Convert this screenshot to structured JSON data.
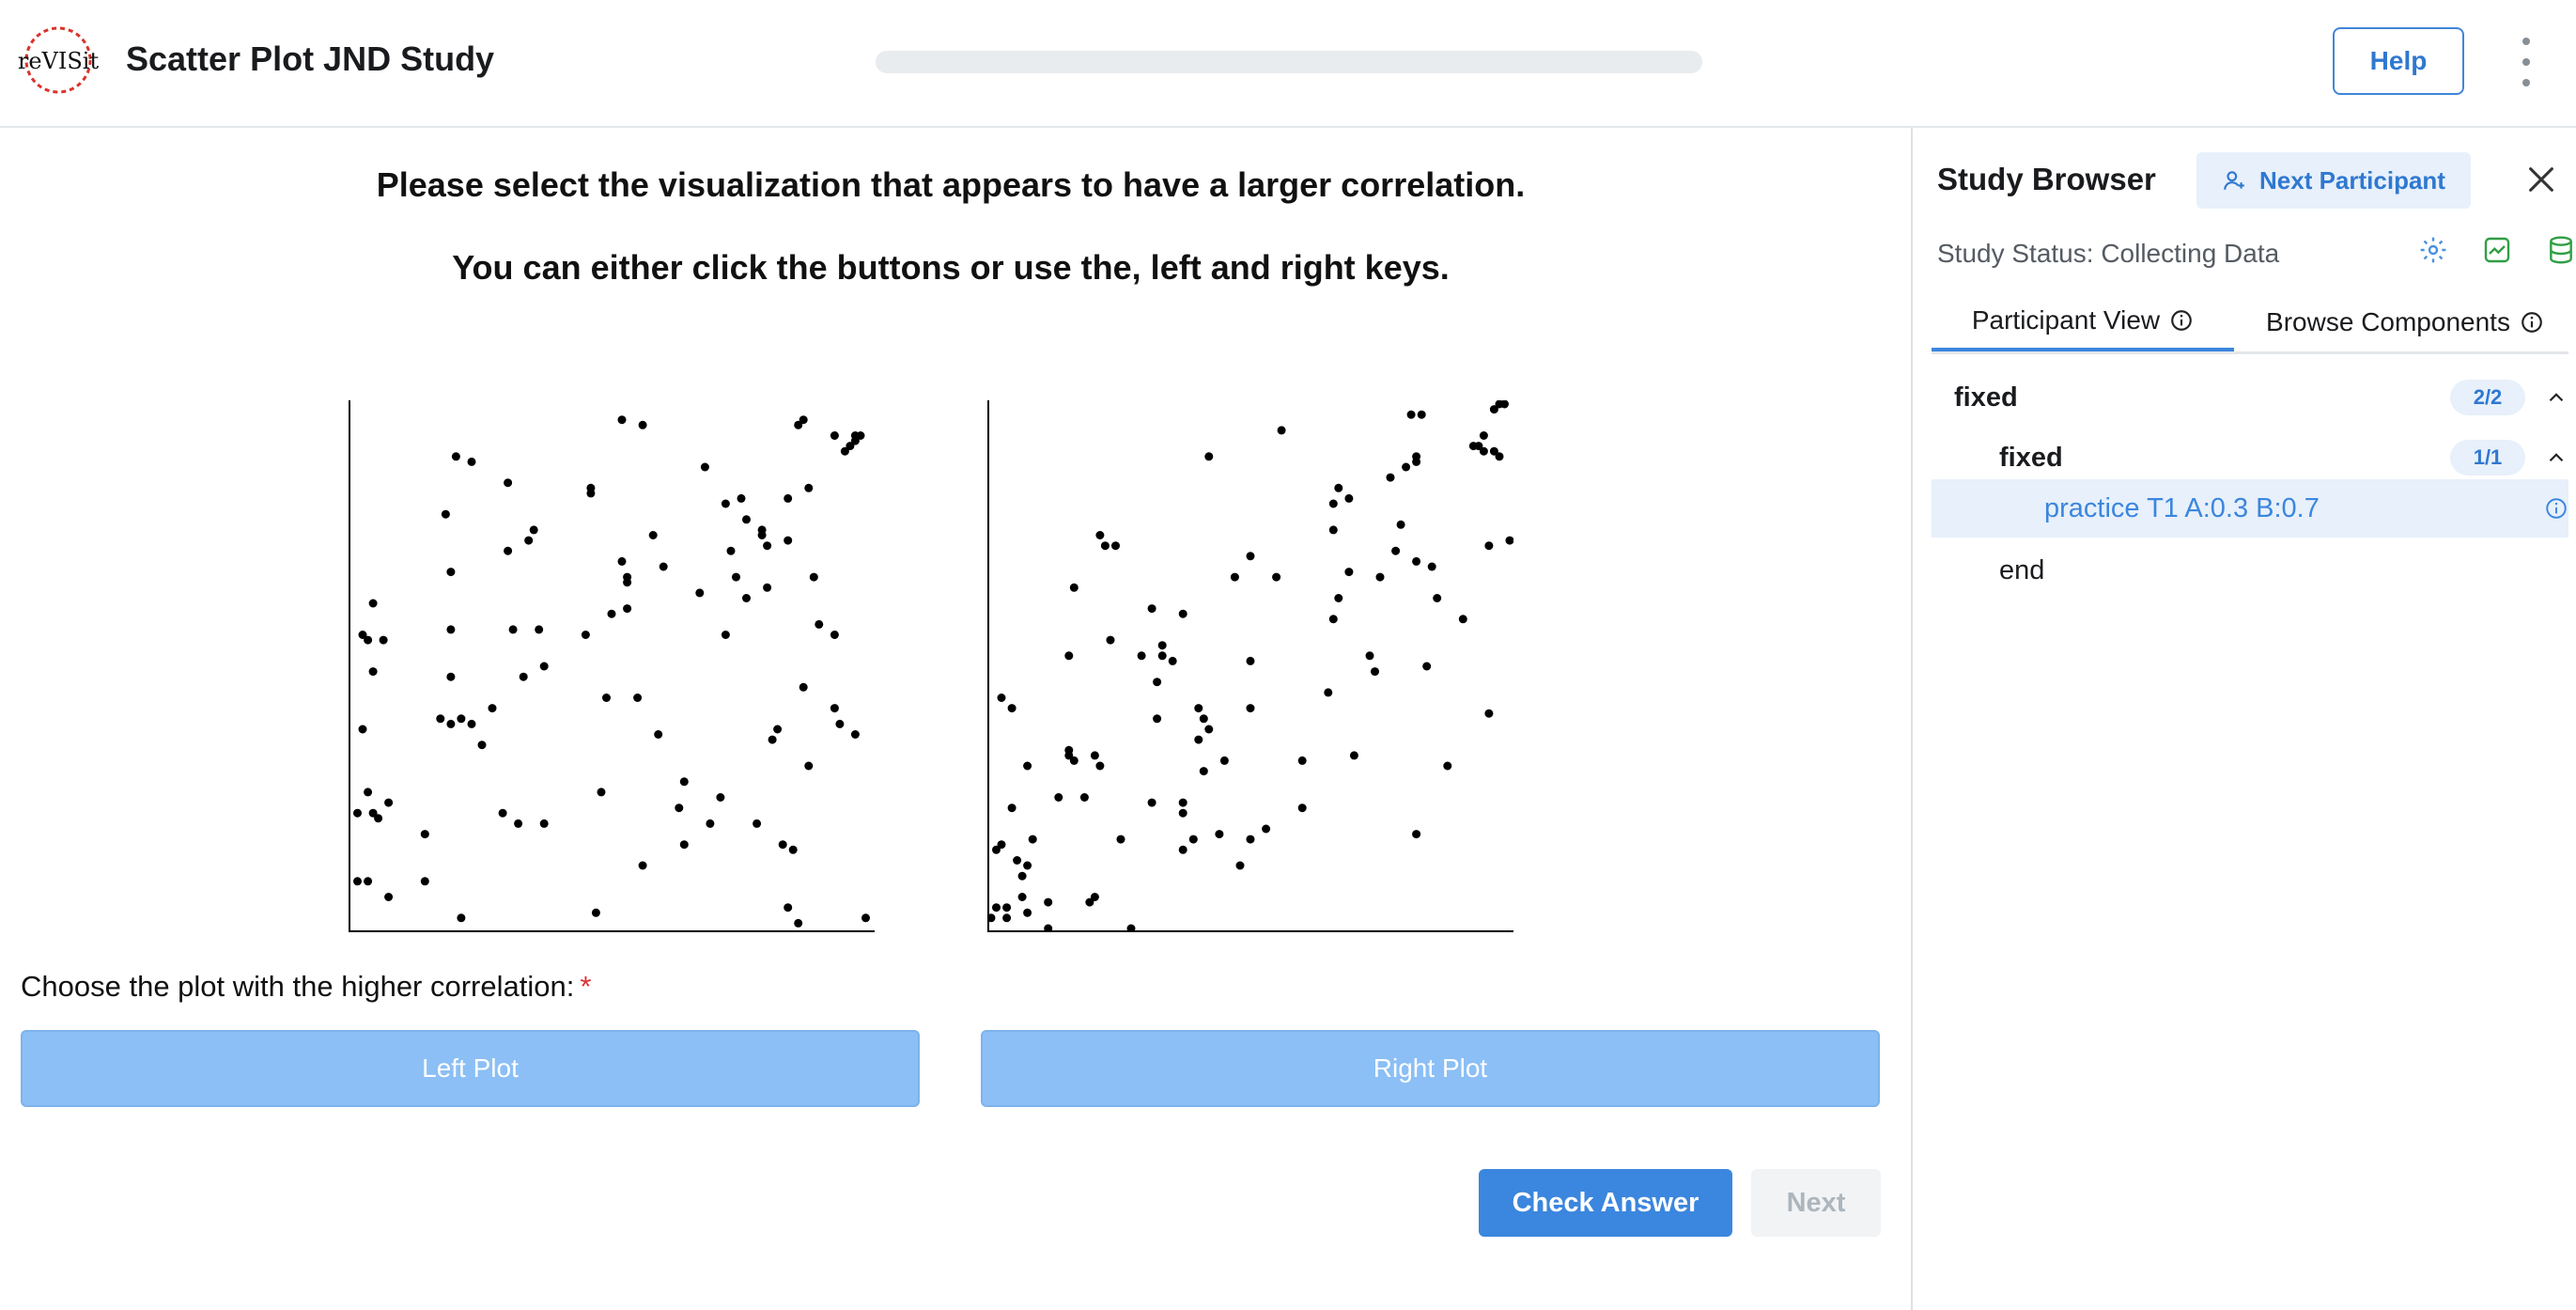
{
  "header": {
    "logo_text": "reVISit",
    "title": "Scatter Plot JND Study",
    "progress": 0,
    "help_label": "Help"
  },
  "main": {
    "instruction_1": "Please select the visualization that appears to have a larger correlation.",
    "instruction_2": "You can either click the buttons or use the, left and right keys.",
    "question": "Choose the plot with the higher correlation:",
    "required_mark": "*",
    "left_button": "Left Plot",
    "right_button": "Right Plot",
    "check_answer": "Check Answer",
    "next": "Next"
  },
  "chart_data": [
    {
      "type": "scatter",
      "title": "",
      "xlim": [
        0,
        1
      ],
      "ylim": [
        0,
        1
      ],
      "points": [
        [
          0.01,
          0.09
        ],
        [
          0.01,
          0.22
        ],
        [
          0.02,
          0.38
        ],
        [
          0.02,
          0.56
        ],
        [
          0.03,
          0.09
        ],
        [
          0.03,
          0.26
        ],
        [
          0.04,
          0.22
        ],
        [
          0.04,
          0.49
        ],
        [
          0.03,
          0.55
        ],
        [
          0.04,
          0.62
        ],
        [
          0.06,
          0.55
        ],
        [
          0.07,
          0.24
        ],
        [
          0.07,
          0.06
        ],
        [
          0.05,
          0.21
        ],
        [
          0.14,
          0.09
        ],
        [
          0.14,
          0.18
        ],
        [
          0.17,
          0.4
        ],
        [
          0.18,
          0.79
        ],
        [
          0.19,
          0.68
        ],
        [
          0.19,
          0.57
        ],
        [
          0.19,
          0.48
        ],
        [
          0.19,
          0.39
        ],
        [
          0.2,
          0.9
        ],
        [
          0.21,
          0.4
        ],
        [
          0.21,
          0.02
        ],
        [
          0.23,
          0.39
        ],
        [
          0.23,
          0.89
        ],
        [
          0.25,
          0.35
        ],
        [
          0.27,
          0.42
        ],
        [
          0.29,
          0.22
        ],
        [
          0.3,
          0.85
        ],
        [
          0.3,
          0.72
        ],
        [
          0.31,
          0.57
        ],
        [
          0.32,
          0.2
        ],
        [
          0.33,
          0.48
        ],
        [
          0.34,
          0.74
        ],
        [
          0.35,
          0.76
        ],
        [
          0.36,
          0.57
        ],
        [
          0.37,
          0.5
        ],
        [
          0.37,
          0.2
        ],
        [
          0.45,
          0.56
        ],
        [
          0.46,
          0.83
        ],
        [
          0.46,
          0.84
        ],
        [
          0.47,
          0.03
        ],
        [
          0.48,
          0.26
        ],
        [
          0.49,
          0.44
        ],
        [
          0.5,
          0.6
        ],
        [
          0.52,
          0.7
        ],
        [
          0.53,
          0.66
        ],
        [
          0.53,
          0.67
        ],
        [
          0.53,
          0.61
        ],
        [
          0.52,
          0.97
        ],
        [
          0.56,
          0.96
        ],
        [
          0.55,
          0.44
        ],
        [
          0.56,
          0.12
        ],
        [
          0.58,
          0.75
        ],
        [
          0.59,
          0.37
        ],
        [
          0.6,
          0.69
        ],
        [
          0.63,
          0.23
        ],
        [
          0.64,
          0.16
        ],
        [
          0.64,
          0.28
        ],
        [
          0.67,
          0.64
        ],
        [
          0.68,
          0.88
        ],
        [
          0.69,
          0.2
        ],
        [
          0.71,
          0.25
        ],
        [
          0.72,
          0.81
        ],
        [
          0.72,
          0.56
        ],
        [
          0.73,
          0.72
        ],
        [
          0.74,
          0.67
        ],
        [
          0.75,
          0.82
        ],
        [
          0.76,
          0.63
        ],
        [
          0.76,
          0.78
        ],
        [
          0.78,
          0.2
        ],
        [
          0.79,
          0.76
        ],
        [
          0.79,
          0.75
        ],
        [
          0.8,
          0.73
        ],
        [
          0.81,
          0.36
        ],
        [
          0.82,
          0.38
        ],
        [
          0.8,
          0.65
        ],
        [
          0.83,
          0.16
        ],
        [
          0.84,
          0.04
        ],
        [
          0.84,
          0.74
        ],
        [
          0.84,
          0.82
        ],
        [
          0.85,
          0.15
        ],
        [
          0.86,
          0.96
        ],
        [
          0.87,
          0.97
        ],
        [
          0.86,
          0.01
        ],
        [
          0.88,
          0.31
        ],
        [
          0.88,
          0.84
        ],
        [
          0.87,
          0.46
        ],
        [
          0.89,
          0.67
        ],
        [
          0.9,
          0.58
        ],
        [
          0.93,
          0.56
        ],
        [
          0.93,
          0.42
        ],
        [
          0.93,
          0.94
        ],
        [
          0.94,
          0.39
        ],
        [
          0.95,
          0.91
        ],
        [
          0.96,
          0.92
        ],
        [
          0.97,
          0.94
        ],
        [
          0.97,
          0.37
        ],
        [
          0.97,
          0.93
        ],
        [
          0.98,
          0.94
        ],
        [
          0.99,
          0.02
        ]
      ]
    },
    {
      "type": "scatter",
      "title": "",
      "xlim": [
        0,
        1
      ],
      "ylim": [
        0,
        1
      ],
      "points": [
        [
          0.0,
          0.02
        ],
        [
          0.01,
          0.04
        ],
        [
          0.01,
          0.15
        ],
        [
          0.02,
          0.16
        ],
        [
          0.02,
          0.44
        ],
        [
          0.03,
          0.04
        ],
        [
          0.03,
          0.02
        ],
        [
          0.04,
          0.42
        ],
        [
          0.04,
          0.23
        ],
        [
          0.05,
          0.13
        ],
        [
          0.06,
          0.06
        ],
        [
          0.06,
          0.1
        ],
        [
          0.07,
          0.03
        ],
        [
          0.07,
          0.12
        ],
        [
          0.08,
          0.17
        ],
        [
          0.07,
          0.31
        ],
        [
          0.11,
          0.05
        ],
        [
          0.11,
          0.0
        ],
        [
          0.13,
          0.25
        ],
        [
          0.15,
          0.33
        ],
        [
          0.15,
          0.52
        ],
        [
          0.15,
          0.34
        ],
        [
          0.16,
          0.32
        ],
        [
          0.16,
          0.65
        ],
        [
          0.18,
          0.25
        ],
        [
          0.19,
          0.05
        ],
        [
          0.2,
          0.06
        ],
        [
          0.2,
          0.33
        ],
        [
          0.21,
          0.31
        ],
        [
          0.21,
          0.75
        ],
        [
          0.22,
          0.73
        ],
        [
          0.23,
          0.55
        ],
        [
          0.24,
          0.73
        ],
        [
          0.25,
          0.17
        ],
        [
          0.27,
          0.0
        ],
        [
          0.29,
          0.52
        ],
        [
          0.31,
          0.24
        ],
        [
          0.31,
          0.61
        ],
        [
          0.32,
          0.47
        ],
        [
          0.32,
          0.4
        ],
        [
          0.33,
          0.52
        ],
        [
          0.33,
          0.54
        ],
        [
          0.35,
          0.51
        ],
        [
          0.37,
          0.24
        ],
        [
          0.37,
          0.22
        ],
        [
          0.37,
          0.15
        ],
        [
          0.37,
          0.6
        ],
        [
          0.39,
          0.17
        ],
        [
          0.4,
          0.36
        ],
        [
          0.4,
          0.42
        ],
        [
          0.41,
          0.3
        ],
        [
          0.42,
          0.38
        ],
        [
          0.41,
          0.4
        ],
        [
          0.42,
          0.9
        ],
        [
          0.44,
          0.18
        ],
        [
          0.45,
          0.32
        ],
        [
          0.47,
          0.67
        ],
        [
          0.48,
          0.12
        ],
        [
          0.5,
          0.17
        ],
        [
          0.5,
          0.42
        ],
        [
          0.5,
          0.51
        ],
        [
          0.5,
          0.71
        ],
        [
          0.53,
          0.19
        ],
        [
          0.55,
          0.67
        ],
        [
          0.56,
          0.95
        ],
        [
          0.6,
          0.32
        ],
        [
          0.6,
          0.23
        ],
        [
          0.65,
          0.45
        ],
        [
          0.66,
          0.59
        ],
        [
          0.66,
          0.76
        ],
        [
          0.66,
          0.81
        ],
        [
          0.67,
          0.63
        ],
        [
          0.67,
          0.84
        ],
        [
          0.69,
          0.68
        ],
        [
          0.69,
          0.82
        ],
        [
          0.7,
          0.33
        ],
        [
          0.73,
          0.52
        ],
        [
          0.74,
          0.49
        ],
        [
          0.75,
          0.67
        ],
        [
          0.77,
          0.86
        ],
        [
          0.78,
          0.72
        ],
        [
          0.79,
          0.77
        ],
        [
          0.8,
          0.88
        ],
        [
          0.81,
          0.98
        ],
        [
          0.82,
          0.89
        ],
        [
          0.82,
          0.9
        ],
        [
          0.83,
          0.98
        ],
        [
          0.82,
          0.7
        ],
        [
          0.82,
          0.18
        ],
        [
          0.84,
          0.5
        ],
        [
          0.85,
          0.69
        ],
        [
          0.86,
          0.63
        ],
        [
          0.88,
          0.31
        ],
        [
          0.91,
          0.59
        ],
        [
          0.93,
          0.92
        ],
        [
          0.94,
          0.92
        ],
        [
          0.95,
          0.94
        ],
        [
          0.95,
          0.91
        ],
        [
          0.96,
          0.41
        ],
        [
          0.96,
          0.73
        ],
        [
          0.97,
          0.91
        ],
        [
          0.97,
          0.99
        ],
        [
          0.98,
          0.9
        ],
        [
          0.98,
          1.0
        ],
        [
          0.99,
          1.0
        ],
        [
          1.0,
          0.74
        ]
      ]
    }
  ],
  "sidebar": {
    "title": "Study Browser",
    "next_participant": "Next Participant",
    "status": "Study Status: Collecting Data",
    "tab_participant": "Participant View",
    "tab_browse": "Browse Components",
    "tree": {
      "root_label": "fixed",
      "root_badge": "2/2",
      "child_label": "fixed",
      "child_badge": "1/1",
      "item_label": "practice T1 A:0.3 B:0.7",
      "end_label": "end"
    }
  },
  "colors": {
    "accent": "#3b86de",
    "choice_button": "#8bbff5",
    "required": "#e03131"
  }
}
